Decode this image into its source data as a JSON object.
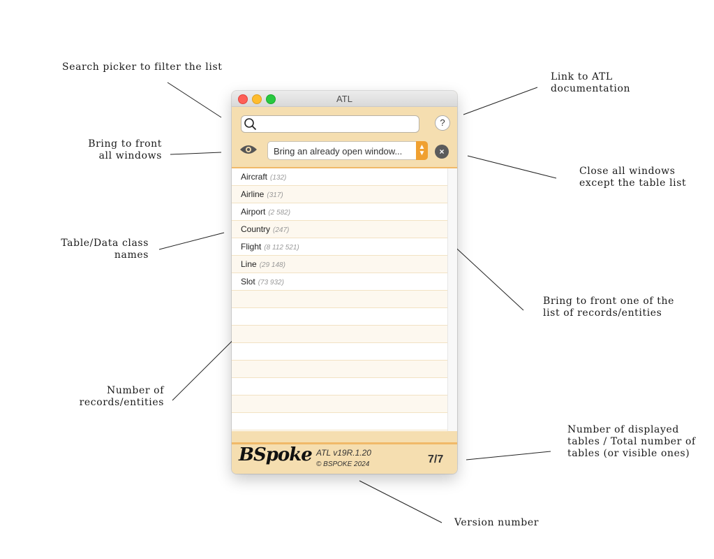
{
  "annotations": {
    "search_picker": "Search picker to filter the list",
    "link_atl_doc": "Link to ATL\ndocumentation",
    "bring_front_all": "Bring to front\nall windows",
    "close_all": "Close all windows\nexcept the table list",
    "table_names": "Table/Data class\nnames",
    "bring_front_one": "Bring to front one of the\nlist of records/entities",
    "num_records": "Number of\nrecords/entities",
    "num_tables": "Number of displayed\ntables / Total number of\ntables (or visible ones)",
    "version_number": "Version number"
  },
  "window": {
    "title": "ATL",
    "search": {
      "value": "",
      "placeholder": ""
    },
    "help_label": "?",
    "window_picker": {
      "selected": "Bring an already open window..."
    },
    "close_all_label": "×"
  },
  "tables": [
    {
      "name": "Aircraft",
      "count": "(132)"
    },
    {
      "name": "Airline",
      "count": "(317)"
    },
    {
      "name": "Airport",
      "count": "(2 582)"
    },
    {
      "name": "Country",
      "count": "(247)"
    },
    {
      "name": "Flight",
      "count": "(8 112 521)"
    },
    {
      "name": "Line",
      "count": "(29 148)"
    },
    {
      "name": "Slot",
      "count": "(73 932)"
    }
  ],
  "footer": {
    "logo": "BSpoke",
    "version": "ATL v19R.1.20",
    "copyright": "© BSPOKE 2024",
    "table_count": "7/7"
  },
  "colors": {
    "panel": "#f5deb0",
    "accent": "#f0a030",
    "separator": "#f0b968"
  }
}
